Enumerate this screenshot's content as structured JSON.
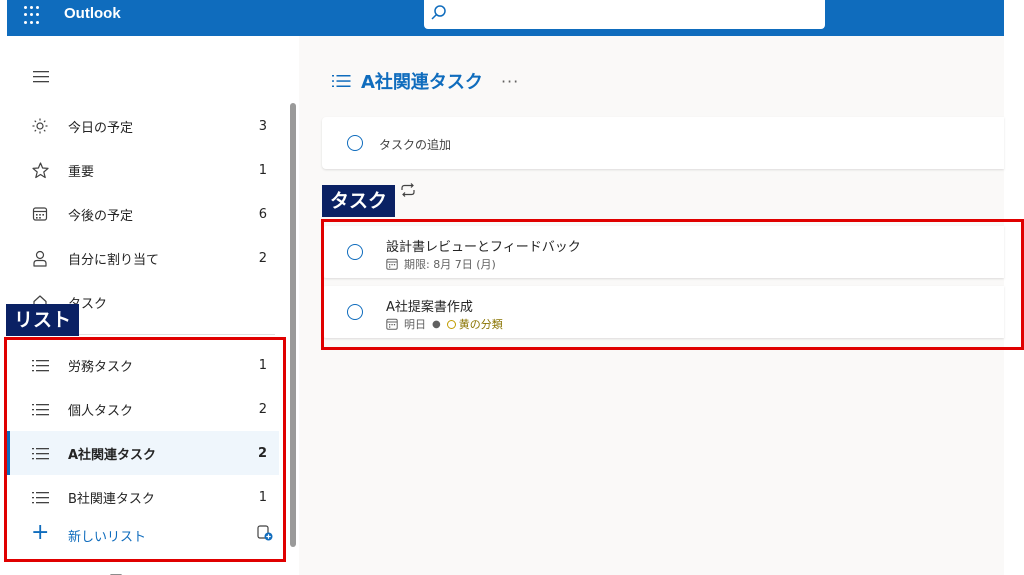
{
  "app": {
    "title": "Outlook",
    "search_placeholder": ""
  },
  "sidebar": {
    "items": [
      {
        "label": "今日の予定",
        "count": "3",
        "icon": "sun-icon"
      },
      {
        "label": "重要",
        "count": "1",
        "icon": "star-icon"
      },
      {
        "label": "今後の予定",
        "count": "6",
        "icon": "calendar-icon"
      },
      {
        "label": "自分に割り当て",
        "count": "2",
        "icon": "person-icon"
      },
      {
        "label": "タスク",
        "count": "",
        "icon": "home-icon"
      }
    ],
    "lists": [
      {
        "label": "労務タスク",
        "count": "1",
        "icon": "list-icon"
      },
      {
        "label": "個人タスク",
        "count": "2",
        "icon": "list-icon"
      },
      {
        "label": "A社関連タスク",
        "count": "2",
        "icon": "list-icon",
        "selected": true
      },
      {
        "label": "B社関連タスク",
        "count": "1",
        "icon": "list-icon"
      }
    ],
    "new_list_label": "新しいリスト"
  },
  "main": {
    "list_title": "A社関連タスク",
    "more_label": "···",
    "add_task_label": "タスクの追加",
    "tasks": [
      {
        "title": "設計書レビューとフィードバック",
        "due": "期限: 8月 7日 (月)"
      },
      {
        "title": "A社提案書作成",
        "due": "明日",
        "category": "黄の分類"
      }
    ]
  },
  "annotations": {
    "list_callout": "リスト",
    "task_callout": "タスク"
  },
  "colors": {
    "brand": "#0f6cbd",
    "callout_bg": "#0a2164",
    "highlight_border": "#e00000",
    "category": "#c19c00"
  }
}
